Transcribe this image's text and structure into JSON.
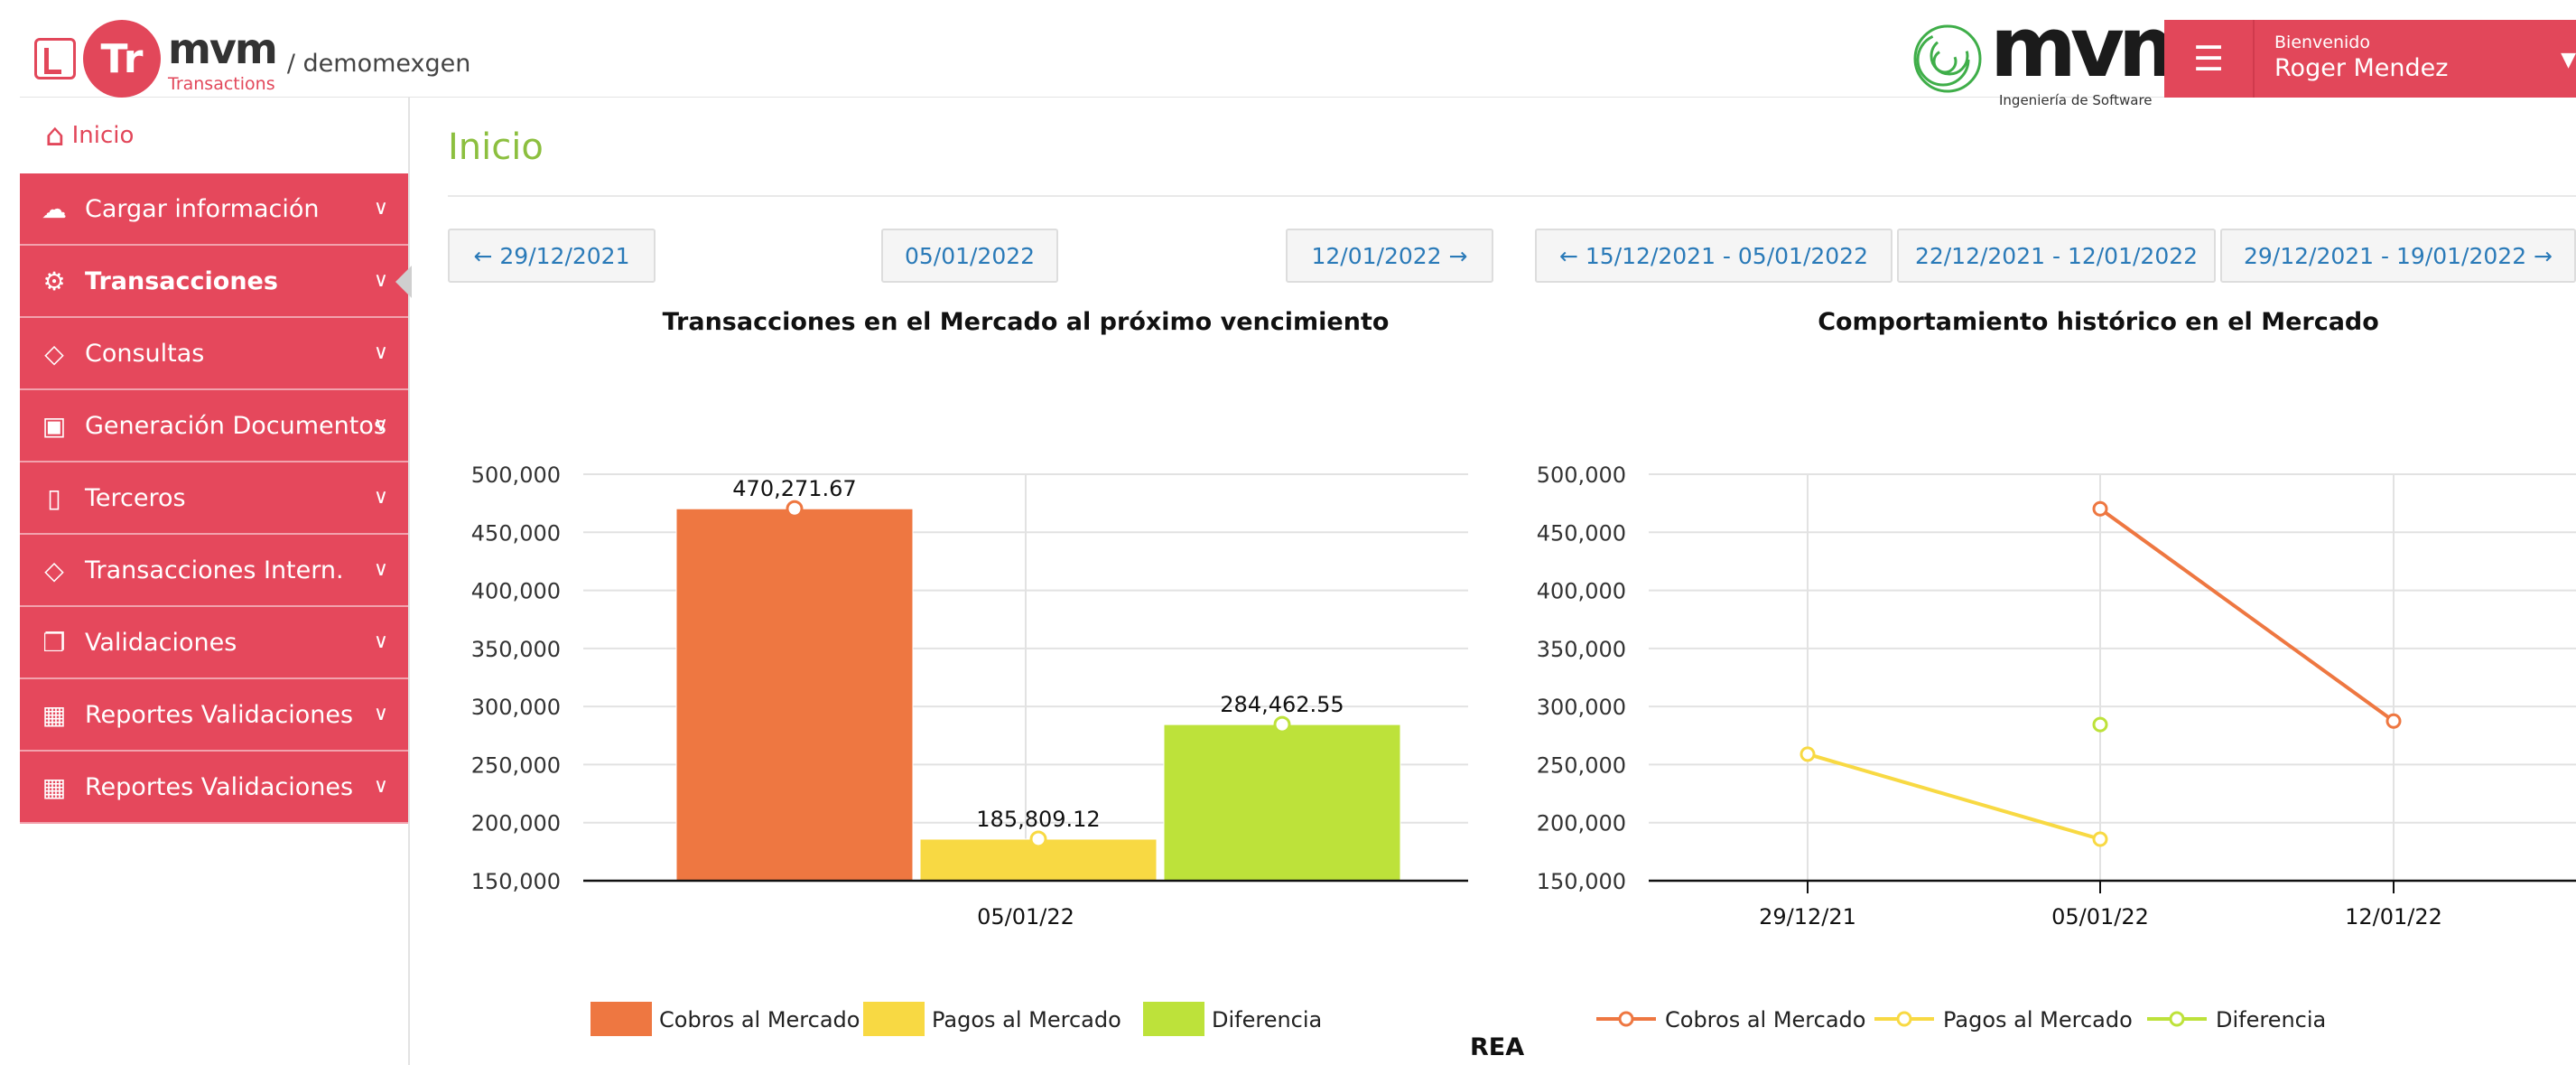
{
  "header": {
    "logo_initials": "Tr",
    "logo_name": "mvm",
    "logo_sub": "Transactions",
    "tenant": "/ demomexgen",
    "brand_name": "mvm",
    "brand_sub": "Ingeniería de Software",
    "menu_icon": "hamburger-icon",
    "welcome": "Bienvenido",
    "user_name": "Roger Mendez"
  },
  "sidebar": {
    "home": {
      "label": "Inicio",
      "icon": "home-icon"
    },
    "items": [
      {
        "label": "Cargar información",
        "icon": "cloud-upload-icon",
        "active": false
      },
      {
        "label": "Transacciones",
        "icon": "gears-icon",
        "active": true
      },
      {
        "label": "Consultas",
        "icon": "diamond-icon",
        "active": false
      },
      {
        "label": "Generación Documentos",
        "icon": "excel-file-icon",
        "active": false
      },
      {
        "label": "Terceros",
        "icon": "file-icon",
        "active": false
      },
      {
        "label": "Transacciones Intern.",
        "icon": "diamond-icon",
        "active": false
      },
      {
        "label": "Validaciones",
        "icon": "documents-icon",
        "active": false
      },
      {
        "label": "Reportes Validaciones",
        "icon": "table-icon",
        "active": false
      },
      {
        "label": "Reportes Validaciones",
        "icon": "table-icon",
        "active": false
      }
    ]
  },
  "main": {
    "title": "Inicio",
    "nav_left": {
      "prev": "← 29/12/2021",
      "current": "05/01/2022",
      "next": "12/01/2022 →"
    },
    "nav_right": {
      "prev": "← 15/12/2021 - 05/01/2022",
      "current": "22/12/2021 - 12/01/2022",
      "next": "29/12/2021 - 19/01/2022 →"
    },
    "footer_label": "REA"
  },
  "colors": {
    "accent": "#e2475a",
    "title_green": "#8cbf3f",
    "link_blue": "#2a7ab8",
    "cobros": "#ee7741",
    "pagos": "#f8d943",
    "diferencia": "#bde23a"
  },
  "chart_data": [
    {
      "type": "bar",
      "title": "Transacciones en el Mercado al próximo vencimiento",
      "categories": [
        "05/01/22"
      ],
      "series": [
        {
          "name": "Cobros al Mercado",
          "values": [
            470271.67
          ],
          "label": "470,271.67"
        },
        {
          "name": "Pagos al Mercado",
          "values": [
            185809.12
          ],
          "label": "185,809.12"
        },
        {
          "name": "Diferencia",
          "values": [
            284462.55
          ],
          "label": "284,462.55"
        }
      ],
      "ylim": [
        150000,
        500000
      ],
      "yticks": [
        150000,
        200000,
        250000,
        300000,
        350000,
        400000,
        450000,
        500000
      ],
      "ytick_labels": [
        "150,000",
        "200,000",
        "250,000",
        "300,000",
        "350,000",
        "400,000",
        "450,000",
        "500,000"
      ],
      "grid": true,
      "legend": "bottom-center"
    },
    {
      "type": "line",
      "title": "Comportamiento histórico en el Mercado",
      "x": [
        "29/12/21",
        "05/01/22",
        "12/01/22"
      ],
      "series": [
        {
          "name": "Cobros al Mercado",
          "values": [
            null,
            470271.67,
            287500
          ]
        },
        {
          "name": "Pagos al Mercado",
          "values": [
            259000,
            185809.12,
            null
          ]
        },
        {
          "name": "Diferencia",
          "values": [
            null,
            284462.55,
            null
          ]
        }
      ],
      "ylim": [
        150000,
        500000
      ],
      "yticks": [
        150000,
        200000,
        250000,
        300000,
        350000,
        400000,
        450000,
        500000
      ],
      "ytick_labels": [
        "150,000",
        "200,000",
        "250,000",
        "300,000",
        "350,000",
        "400,000",
        "450,000",
        "500,000"
      ],
      "grid": true,
      "legend": "bottom-center"
    }
  ]
}
